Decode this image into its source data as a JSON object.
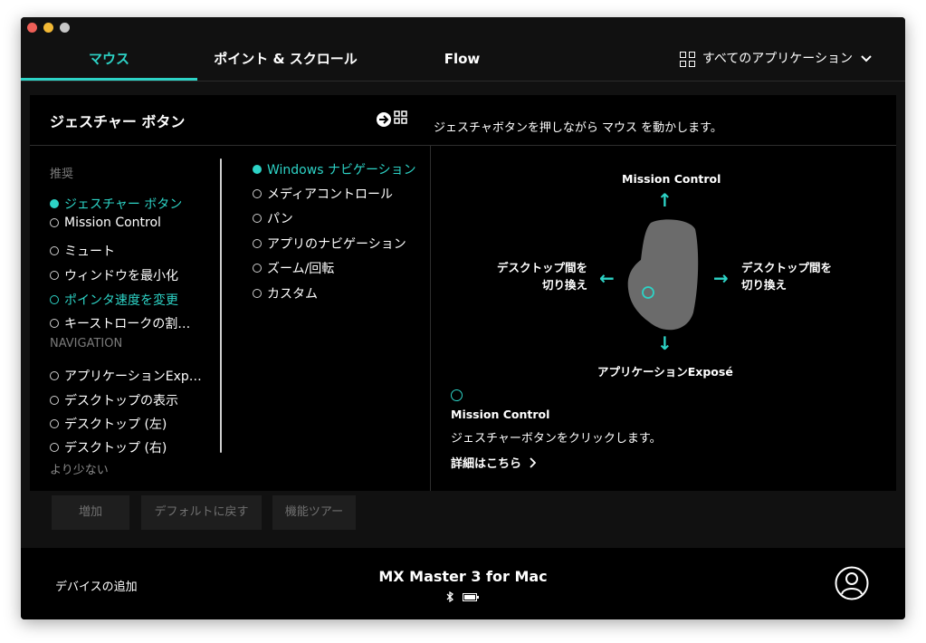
{
  "tabs": [
    {
      "label": "マウス",
      "active": true
    },
    {
      "label": "ポイント & スクロール",
      "active": false
    },
    {
      "label": "Flow",
      "active": false
    }
  ],
  "app_selector": {
    "label": "すべてのアプリケーション",
    "icon": "grid-icon"
  },
  "panel": {
    "title": "ジェスチャー ボタン",
    "description": "ジェスチャボタンを押しながら マウス を動かします。"
  },
  "col1": {
    "section_recommended": "推奨",
    "recommended": [
      "ジェスチャー ボタン",
      "Mission Control",
      "ミュート",
      "ウィンドウを最小化",
      "ポインタ速度を変更",
      "キーストロークの割…"
    ],
    "section_navigation": "NAVIGATION",
    "navigation": [
      "アプリケーションExp…",
      "デスクトップの表示",
      "デスクトップ (左)",
      "デスクトップ (右)"
    ],
    "less": "より少ない"
  },
  "col2": {
    "options": [
      "Windows ナビゲーション",
      "メディアコントロール",
      "パン",
      "アプリのナビゲーション",
      "ズーム/回転",
      "カスタム"
    ]
  },
  "diagram": {
    "up": "Mission Control",
    "left_line1": "デスクトップ間を",
    "left_line2": "切り換え",
    "right_line1": "デスクトップ間を",
    "right_line2": "切り換え",
    "down": "アプリケーションExposé",
    "click_title": "Mission Control",
    "click_desc": "ジェスチャーボタンをクリックします。",
    "more_link": "詳細はこちら",
    "accent_color": "#2dd3c6"
  },
  "buttons": {
    "add": "増加",
    "reset": "デフォルトに戻す",
    "tour": "機能ツアー"
  },
  "footer": {
    "add_device": "デバイスの追加",
    "device_name": "MX Master 3 for Mac",
    "icons": [
      "bluetooth-icon",
      "battery-icon"
    ]
  }
}
